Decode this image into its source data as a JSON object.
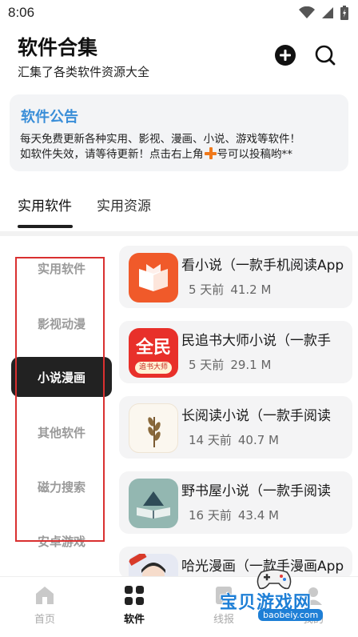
{
  "status_bar": {
    "time": "8:06"
  },
  "header": {
    "title": "软件合集",
    "subtitle": "汇集了各类软件资源大全",
    "add_icon": "plus-circle-icon",
    "search_icon": "search-icon"
  },
  "notice": {
    "title": "软件公告",
    "line1": "每天免费更新各种实用、影视、漫画、小说、游戏等软件！",
    "line2_before": "如软件失效，请等待更新！点击右上角",
    "line2_after": "号可以投稿哟**"
  },
  "tabs": [
    {
      "label": "实用软件",
      "active": true
    },
    {
      "label": "实用资源",
      "active": false
    }
  ],
  "categories": [
    {
      "label": "实用软件"
    },
    {
      "label": "影视动漫"
    },
    {
      "label": "小说漫画",
      "active": true
    },
    {
      "label": "其他软件"
    },
    {
      "label": "磁力搜索"
    },
    {
      "label": "安卓游戏"
    }
  ],
  "apps": [
    {
      "name": "看小说（一款手机阅读App",
      "time": "5 天前",
      "size": "41.2 M",
      "icon": "book-icon"
    },
    {
      "name": "民追书大师小说（一款手",
      "time": "5 天前",
      "size": "29.1 M",
      "icon": "quanmin-logo",
      "icon_text_top": "全民",
      "icon_text_bottom": "追书大师"
    },
    {
      "name": "长阅读小说（一款手阅读",
      "time": "14 天前",
      "size": "40.7 M",
      "icon": "wheat-icon"
    },
    {
      "name": "野书屋小说（一款手阅读",
      "time": "16 天前",
      "size": "43.4 M",
      "icon": "open-book-icon"
    },
    {
      "name": "哈光漫画（一款手漫画App",
      "time": "",
      "size": "",
      "icon": "avatar-icon"
    }
  ],
  "bottom_nav": [
    {
      "label": "首页",
      "icon": "home-icon"
    },
    {
      "label": "软件",
      "icon": "grid-icon",
      "active": true
    },
    {
      "label": "线报",
      "icon": "news-icon"
    },
    {
      "label": "我的",
      "icon": "user-icon"
    }
  ],
  "watermark": {
    "text": "宝贝游戏网",
    "domain": "baobeiy.com"
  },
  "colors": {
    "accent": "#3a8ed8",
    "active_dark": "#222222",
    "plus_orange": "#f07a1c",
    "card_bg": "#f4f4f5"
  }
}
